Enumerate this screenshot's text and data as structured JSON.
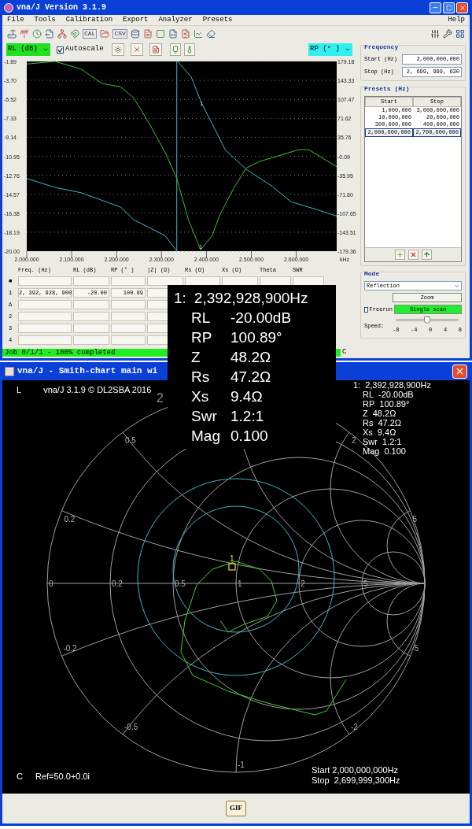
{
  "window": {
    "title": "vna/J Version 3.1.9"
  },
  "menu": [
    {
      "label": "File"
    },
    {
      "label": "Tools"
    },
    {
      "label": "Calibration"
    },
    {
      "label": "Export"
    },
    {
      "label": "Analyzer"
    },
    {
      "label": "Presets"
    }
  ],
  "help_menu": "Help",
  "toolbar_texts": [
    "CAL",
    "CSV"
  ],
  "controls": {
    "autoscale": {
      "label": "Autoscale",
      "checked": true
    }
  },
  "chart": {
    "marker_labels": [
      "1",
      "1"
    ],
    "chart_data": {
      "type": "line",
      "grid": true,
      "xlabel": "kHz",
      "xlim": [
        2000000,
        2690000
      ],
      "ylim": [
        -20.0,
        -1.89
      ],
      "y2lim": [
        -179.36,
        179.18
      ],
      "xticks": [
        {
          "value": 2000000,
          "label": "2.000.000"
        },
        {
          "value": 2100000,
          "label": "2.100.000"
        },
        {
          "value": 2200000,
          "label": "2.200.000"
        },
        {
          "value": 2300000,
          "label": "2.300.000"
        },
        {
          "value": 2400000,
          "label": "2.400.000"
        },
        {
          "value": 2500000,
          "label": "2.500.000"
        },
        {
          "value": 2600000,
          "label": "2.600.000"
        }
      ],
      "yticks": [
        {
          "value": -1.89,
          "label": "-1.89"
        },
        {
          "value": -3.7,
          "label": "-3.70"
        },
        {
          "value": -5.52,
          "label": "-5.52"
        },
        {
          "value": -7.33,
          "label": "-7.33"
        },
        {
          "value": -9.14,
          "label": "-9.14"
        },
        {
          "value": -10.95,
          "label": "-10.95"
        },
        {
          "value": -12.76,
          "label": "-12.76"
        },
        {
          "value": -14.57,
          "label": "-14.57"
        },
        {
          "value": -16.38,
          "label": "-16.38"
        },
        {
          "value": -18.19,
          "label": "-18.19"
        },
        {
          "value": -20.0,
          "label": "-20.00"
        }
      ],
      "y2ticks": [
        {
          "value": 179.18,
          "label": "179.18"
        },
        {
          "value": 143.33,
          "label": "143.33"
        },
        {
          "value": 107.47,
          "label": "107.47"
        },
        {
          "value": 71.62,
          "label": "71.62"
        },
        {
          "value": 35.76,
          "label": "35.76"
        },
        {
          "value": -0.09,
          "label": "-0.09"
        },
        {
          "value": -35.95,
          "label": "-35.95"
        },
        {
          "value": -71.8,
          "label": "-71.80"
        },
        {
          "value": -107.65,
          "label": "-107.65"
        },
        {
          "value": -143.51,
          "label": "-143.51"
        },
        {
          "value": -179.36,
          "label": "-179.36"
        }
      ],
      "x": [
        2000000,
        2063000,
        2121000,
        2168000,
        2209000,
        2238000,
        2273000,
        2308000,
        2334000,
        2336000,
        2360000,
        2366000,
        2387000,
        2389000,
        2413000,
        2430000,
        2442000,
        2460000,
        2489000,
        2518000,
        2547000,
        2558000,
        2588000,
        2605000,
        2628000,
        2646000,
        2690000
      ],
      "series": [
        {
          "name": "RL (dB)",
          "color": "#3fbf2f",
          "values": [
            -2.14,
            -1.89,
            -2.63,
            -4.0,
            -4.32,
            -5.36,
            -7.84,
            -10.57,
            -13.05,
            null,
            -17.02,
            null,
            -19.88,
            null,
            -18.51,
            -16.53,
            null,
            -14.05,
            -12.06,
            -11.44,
            null,
            -10.94,
            null,
            -10.32,
            -10.32,
            null,
            -11.94
          ]
        },
        {
          "name": "RP (° )",
          "color": "#3fb8c8",
          "axis": "y2",
          "values": [
            -42,
            -59,
            -69,
            null,
            -96,
            -120,
            null,
            -150,
            -179.36,
            179.18,
            null,
            150,
            null,
            101,
            61,
            null,
            12,
            null,
            -25,
            null,
            -57,
            null,
            -86,
            null,
            null,
            -101,
            -113
          ]
        }
      ]
    }
  },
  "table": {
    "columns": [
      "Freq. (Hz)",
      "RL (dB)",
      "RP (° )",
      "|Z| (Ω)",
      "Rs (Ω)",
      "Xs (Ω)",
      "Theta",
      "SWR"
    ],
    "rows": [
      {
        "label": "■",
        "cells": []
      },
      {
        "label": "1",
        "cells": [
          "2, 392, 928, 900",
          "-20.00",
          "100.89"
        ]
      },
      {
        "label": "Δ",
        "cells": []
      },
      {
        "label": "2",
        "cells": []
      },
      {
        "label": "3",
        "cells": []
      },
      {
        "label": "4",
        "cells": []
      }
    ]
  },
  "status_bar": {
    "text": "Job 0/1/1 - 100% completed",
    "level": 1,
    "right": "C"
  },
  "frequency": {
    "title": "Frequency",
    "start_label": "Start (Hz)",
    "start": "2,000,000,000",
    "stop_label": "Stop (Hz)",
    "stop": "2, 699, 999, 630"
  },
  "presets": {
    "title": "Presets (Hz)",
    "columns": [
      "Start",
      "Stop"
    ],
    "rows": [
      {
        "start": "1,000,000",
        "stop": "3,000,000,000",
        "selected": false
      },
      {
        "start": "10,000,000",
        "stop": "20,000,000",
        "selected": false
      },
      {
        "start": "300,000,000",
        "stop": "400,000,000",
        "selected": false
      },
      {
        "start": "2,000,000,000",
        "stop": "2,700,000,000",
        "selected": true
      }
    ]
  },
  "mode": {
    "title": "Mode",
    "value": "Reflection",
    "zoom": "Zoom",
    "freerun": {
      "label": "Freerun",
      "checked": false
    },
    "scan": "Single scan",
    "speed_label": "Speed:",
    "speed": {
      "level": 0.5
    },
    "speed_ticks": [
      "-8",
      "-4",
      "0",
      "4",
      "8"
    ]
  },
  "marker_popup": [
    {
      "label": "1:",
      "value": "2,392,928,900Hz"
    },
    {
      "label": "RL",
      "value": "-20.00dB"
    },
    {
      "label": "RP",
      "value": "100.89°"
    },
    {
      "label": "Z",
      "value": "48.2Ω"
    },
    {
      "label": "Rs",
      "value": "47.2Ω"
    },
    {
      "label": "Xs",
      "value": "9.4Ω"
    },
    {
      "label": "Swr",
      "value": "1.2:1"
    },
    {
      "label": "Mag",
      "value": "0.100"
    }
  ],
  "smith": {
    "title": "vna/J - Smith-chart main wi",
    "corner_top": "L",
    "version": "vna/J 3.1.9 © DL2SBA 2016",
    "stray_label": "2",
    "readout": [
      {
        "label": "1:",
        "value": "2,392,928,900Hz"
      },
      {
        "label": "RL",
        "value": "-20.00dB"
      },
      {
        "label": "RP",
        "value": "100.89°"
      },
      {
        "label": "Z",
        "value": "48.2Ω"
      },
      {
        "label": "Rs",
        "value": "47.2Ω"
      },
      {
        "label": "Xs",
        "value": "9.4Ω"
      },
      {
        "label": "Swr",
        "value": "1.2:1"
      },
      {
        "label": "Mag",
        "value": "0.100"
      }
    ],
    "resistance_labels": [
      "0",
      "0.2",
      "0.5",
      "1",
      "2",
      "5"
    ],
    "reactance_labels": [
      "0.2",
      "0.5",
      "2",
      "5",
      "-0.2",
      "-0.5",
      "-1",
      "-2",
      "-5"
    ],
    "marker_label": "1",
    "corner_bottom": "C",
    "reference": "Ref=50.0+0.0i",
    "start": "Start 2,000,000,000Hz",
    "stop": "Stop  2,699,999,300Hz",
    "gif_button": "GIF"
  }
}
